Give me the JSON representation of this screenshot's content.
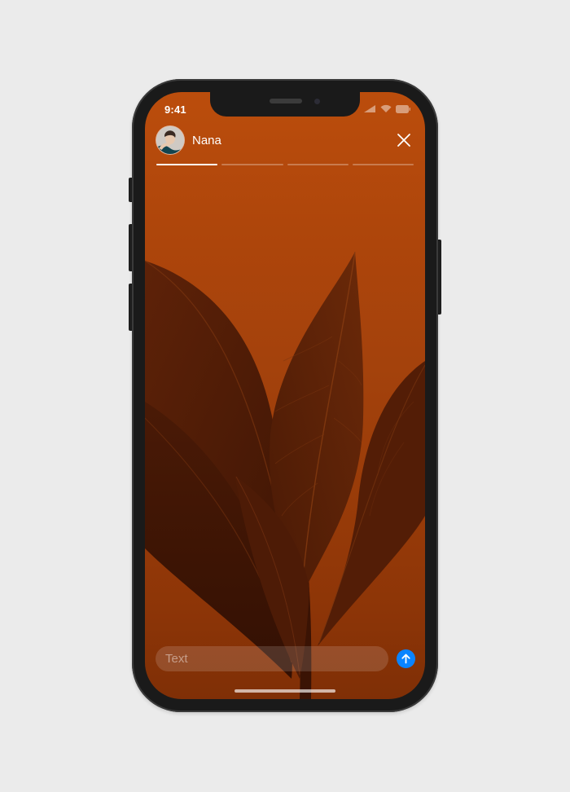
{
  "status_bar": {
    "time": "9:41",
    "icons": [
      "cellular-signal-icon",
      "wifi-icon",
      "battery-icon"
    ]
  },
  "story": {
    "user_name": "Nana",
    "avatar_icon": "user-avatar",
    "segments_total": 4,
    "current_segment": 1,
    "segment_progress": [
      1,
      0,
      0,
      0
    ],
    "background_image": "plant-leaves-photo"
  },
  "composer": {
    "placeholder": "Text",
    "value": "",
    "send_icon": "arrow-up-icon"
  },
  "colors": {
    "background_top": "#bb4d0c",
    "background_bottom": "#7f2f06",
    "send_button": "#0a84ff",
    "progress_active": "#ffffff"
  }
}
